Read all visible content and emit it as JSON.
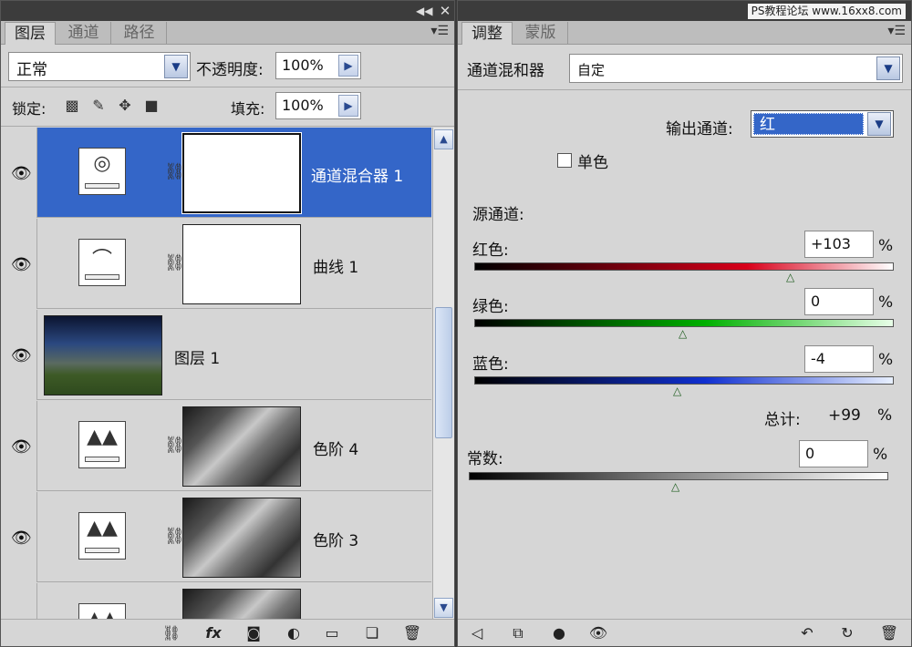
{
  "left_panel": {
    "tabs": [
      "图层",
      "通道",
      "路径"
    ],
    "active_tab": 0,
    "blend_mode": "正常",
    "opacity_label": "不透明度:",
    "opacity_value": "100%",
    "lock_label": "锁定:",
    "fill_label": "填充:",
    "fill_value": "100%",
    "layers": [
      {
        "name": "通道混合器 1",
        "kind": "channel-mixer",
        "selected": true,
        "visible": true
      },
      {
        "name": "曲线 1",
        "kind": "curves",
        "selected": false,
        "visible": true
      },
      {
        "name": "图层 1",
        "kind": "photo",
        "selected": false,
        "visible": true
      },
      {
        "name": "色阶 4",
        "kind": "levels",
        "selected": false,
        "visible": true
      },
      {
        "name": "色阶 3",
        "kind": "levels",
        "selected": false,
        "visible": true
      },
      {
        "name": "",
        "kind": "levels",
        "selected": false,
        "visible": false
      }
    ],
    "bottom_icons": [
      "link-icon",
      "fx-icon",
      "add-mask-icon",
      "new-adjustment-icon",
      "new-group-icon",
      "new-layer-icon",
      "trash-icon"
    ]
  },
  "right_panel": {
    "tabs": [
      "调整",
      "蒙版"
    ],
    "active_tab": 0,
    "watermark": "PS教程论坛 www.16xx8.com",
    "adjustment_title": "通道混和器",
    "preset_value": "自定",
    "output_channel_label": "输出通道:",
    "output_channel_value": "红",
    "monochrome_label": "单色",
    "monochrome_checked": false,
    "source_channels_label": "源通道:",
    "red_label": "红色:",
    "red_value": "+103",
    "green_label": "绿色:",
    "green_value": "0",
    "blue_label": "蓝色:",
    "blue_value": "-4",
    "percent": "%",
    "total_label": "总计:",
    "total_value": "+99",
    "constant_label": "常数:",
    "constant_value": "0",
    "bottom_icons": [
      "back-icon",
      "clip-icon",
      "toggle-view-icon",
      "eye-icon",
      "previous-state-icon",
      "reset-icon",
      "trash-icon"
    ]
  }
}
